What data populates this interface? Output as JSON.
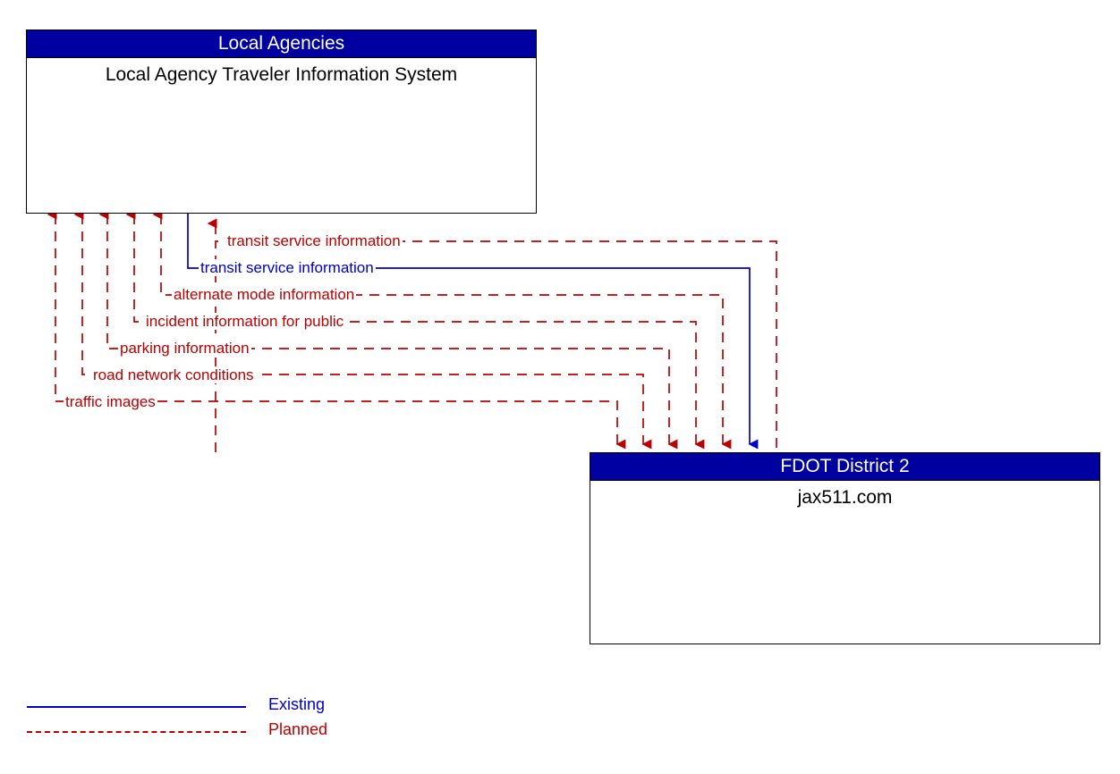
{
  "diagram": {
    "title": "Local Agency Traveler Information System / FDOT District 2 jax511.com interfaces",
    "colors": {
      "header_bg": "#0000A0",
      "header_text": "#FFFFFF",
      "planned": "#BB0000",
      "existing": "#0000CC",
      "box_border": "#000000",
      "background": "#FFFFFF"
    }
  },
  "nodes": [
    {
      "id": "local-agency-traveler-information-system",
      "stakeholder": "Local Agencies",
      "name": "Local Agency Traveler Information System"
    },
    {
      "id": "jax511",
      "stakeholder": "FDOT District 2",
      "name": "jax511.com"
    }
  ],
  "flows": [
    {
      "name": "transit service information",
      "status": "Planned",
      "from": "jax511",
      "to": "local-agency-traveler-information-system"
    },
    {
      "name": "transit service information",
      "status": "Existing",
      "from": "local-agency-traveler-information-system",
      "to": "jax511"
    },
    {
      "name": "alternate mode information",
      "status": "Planned",
      "from": "jax511",
      "to": "local-agency-traveler-information-system"
    },
    {
      "name": "incident information for public",
      "status": "Planned",
      "from": "jax511",
      "to": "local-agency-traveler-information-system"
    },
    {
      "name": "parking information",
      "status": "Planned",
      "from": "jax511",
      "to": "local-agency-traveler-information-system"
    },
    {
      "name": "road network conditions",
      "status": "Planned",
      "from": "jax511",
      "to": "local-agency-traveler-information-system"
    },
    {
      "name": "traffic images",
      "status": "Planned",
      "from": "jax511",
      "to": "local-agency-traveler-information-system"
    }
  ],
  "legend": {
    "existing_label": "Existing",
    "planned_label": "Planned"
  }
}
